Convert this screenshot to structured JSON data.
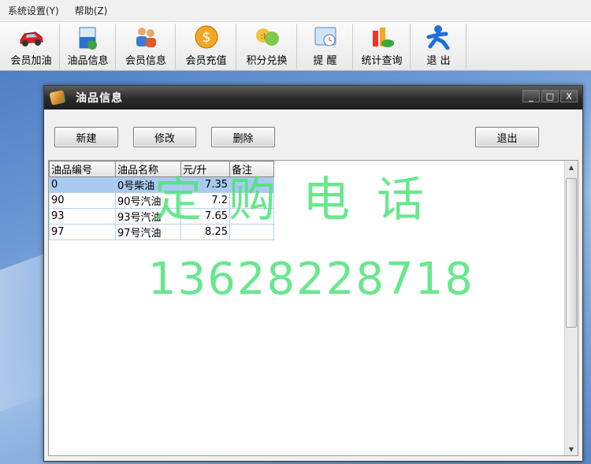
{
  "menu": {
    "items": [
      "系统设置(Y)",
      "帮助(Z)"
    ]
  },
  "toolbar": {
    "buttons": [
      {
        "label": "会员加油",
        "icon": "red-car-icon"
      },
      {
        "label": "油品信息",
        "icon": "oil-beaker-icon"
      },
      {
        "label": "会员信息",
        "icon": "members-icon"
      },
      {
        "label": "会员充值",
        "icon": "coin-recharge-icon"
      },
      {
        "label": "积分兑换",
        "icon": "points-exchange-icon"
      },
      {
        "label": "提  醒",
        "icon": "reminder-icon"
      },
      {
        "label": "统计查询",
        "icon": "statistics-icon"
      },
      {
        "label": "退  出",
        "icon": "exit-person-icon"
      }
    ]
  },
  "window": {
    "title": "油品信息",
    "controls": [
      "_",
      "□",
      "X"
    ],
    "buttons": {
      "new": "新建",
      "edit": "修改",
      "delete": "删除",
      "exit": "退出"
    }
  },
  "grid": {
    "columns": [
      "油品编号",
      "油品名称",
      "元/升",
      "备注"
    ],
    "rows": [
      {
        "code": "0",
        "name": "0号柴油",
        "price": "7.35",
        "note": ""
      },
      {
        "code": "90",
        "name": "90号汽油",
        "price": "7.2",
        "note": ""
      },
      {
        "code": "93",
        "name": "93号汽油",
        "price": "7.65",
        "note": ""
      },
      {
        "code": "97",
        "name": "97号汽油",
        "price": "8.25",
        "note": ""
      }
    ]
  },
  "watermark": {
    "line1": "定购电话",
    "line2": "13628228718"
  },
  "colors": {
    "watermark": "#4fe37a",
    "selected_row": "#a8caf0",
    "titlebar": "#2d2d2d"
  }
}
